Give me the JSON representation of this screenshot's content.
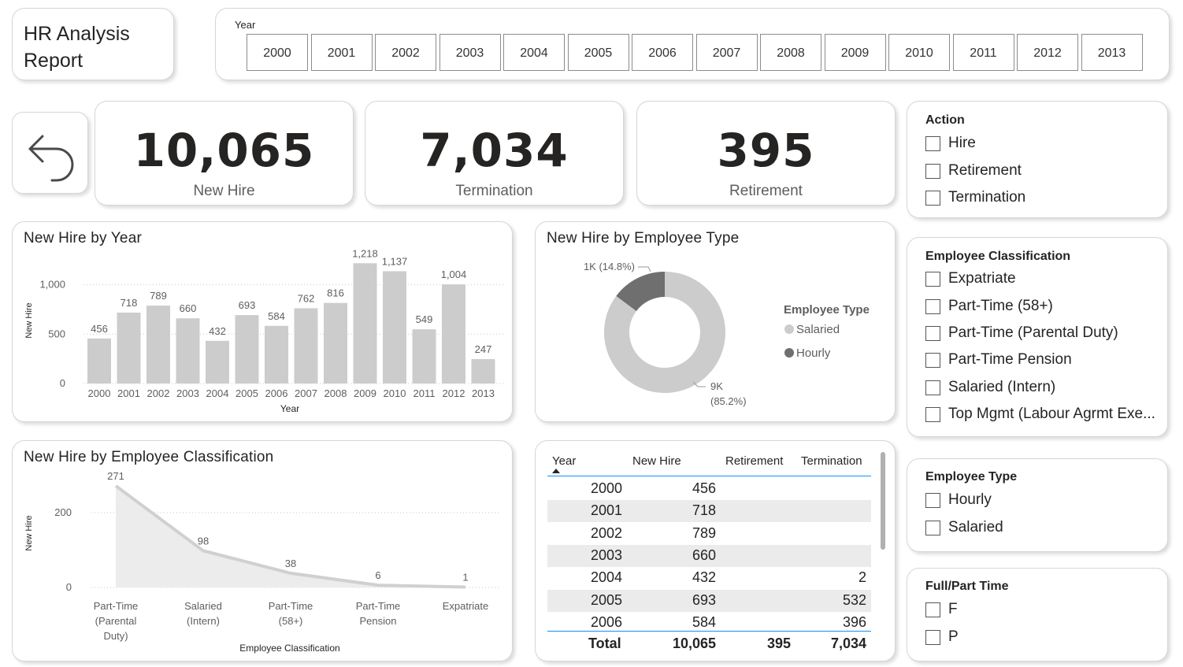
{
  "title": "HR Analysis Report",
  "year_slicer": {
    "label": "Year",
    "years": [
      "2000",
      "2001",
      "2002",
      "2003",
      "2004",
      "2005",
      "2006",
      "2007",
      "2008",
      "2009",
      "2010",
      "2011",
      "2012",
      "2013"
    ]
  },
  "kpis": [
    {
      "value": "10,065",
      "caption": "New Hire"
    },
    {
      "value": "7,034",
      "caption": "Termination"
    },
    {
      "value": "395",
      "caption": "Retirement"
    }
  ],
  "slicers": {
    "action": {
      "header": "Action",
      "options": [
        "Hire",
        "Retirement",
        "Termination"
      ]
    },
    "employee_classification": {
      "header": "Employee Classification",
      "options": [
        "Expatriate",
        "Part-Time (58+)",
        "Part-Time (Parental Duty)",
        "Part-Time Pension",
        "Salaried (Intern)",
        "Top Mgmt (Labour Agrmt Exe..."
      ]
    },
    "employee_type": {
      "header": "Employee Type",
      "options": [
        "Hourly",
        "Salaried"
      ]
    },
    "full_part_time": {
      "header": "Full/Part Time",
      "options": [
        "F",
        "P"
      ]
    }
  },
  "chart_data": [
    {
      "type": "bar",
      "title": "New Hire by Year",
      "xlabel": "Year",
      "ylabel": "New Hire",
      "categories": [
        "2000",
        "2001",
        "2002",
        "2003",
        "2004",
        "2005",
        "2006",
        "2007",
        "2008",
        "2009",
        "2010",
        "2011",
        "2012",
        "2013"
      ],
      "values": [
        456,
        718,
        789,
        660,
        432,
        693,
        584,
        762,
        816,
        1218,
        1137,
        549,
        1004,
        247
      ],
      "value_labels": [
        "456",
        "718",
        "789",
        "660",
        "432",
        "693",
        "584",
        "762",
        "816",
        "1,218",
        "1,137",
        "549",
        "1,004",
        "247"
      ],
      "yticks": [
        0,
        500,
        1000
      ],
      "ytick_labels": [
        "0",
        "500",
        "1,000"
      ],
      "ylim": [
        0,
        1300
      ],
      "grid": true,
      "color": "#cccccc"
    },
    {
      "type": "pie",
      "title": "New Hire by Employee Type",
      "legend_title": "Employee Type",
      "legend_position": "right",
      "slices": [
        {
          "name": "Salaried",
          "label": "9K",
          "pct_label": "(85.2%)",
          "percent": 85.2,
          "color": "#cccccc"
        },
        {
          "name": "Hourly",
          "label": "1K (14.8%)",
          "percent": 14.8,
          "color": "#6f6f6f"
        }
      ]
    },
    {
      "type": "area",
      "title": "New Hire by Employee Classification",
      "xlabel": "Employee Classification",
      "ylabel": "New Hire",
      "categories": [
        [
          "Part-Time",
          "(Parental",
          "Duty)"
        ],
        [
          "Salaried",
          "(Intern)"
        ],
        [
          "Part-Time",
          "(58+)"
        ],
        [
          "Part-Time",
          "Pension"
        ],
        [
          "Expatriate"
        ]
      ],
      "values": [
        271,
        98,
        38,
        6,
        1
      ],
      "yticks": [
        0,
        200
      ],
      "ylim": [
        0,
        290
      ],
      "grid": true,
      "color": "#cccccc"
    }
  ],
  "table": {
    "columns": [
      "Year",
      "New Hire",
      "Retirement",
      "Termination"
    ],
    "rows": [
      [
        "2000",
        "456",
        "",
        ""
      ],
      [
        "2001",
        "718",
        "",
        ""
      ],
      [
        "2002",
        "789",
        "",
        ""
      ],
      [
        "2003",
        "660",
        "",
        ""
      ],
      [
        "2004",
        "432",
        "",
        "2"
      ],
      [
        "2005",
        "693",
        "",
        "532"
      ],
      [
        "2006",
        "584",
        "",
        "396"
      ]
    ],
    "total": [
      "Total",
      "10,065",
      "395",
      "7,034"
    ]
  }
}
